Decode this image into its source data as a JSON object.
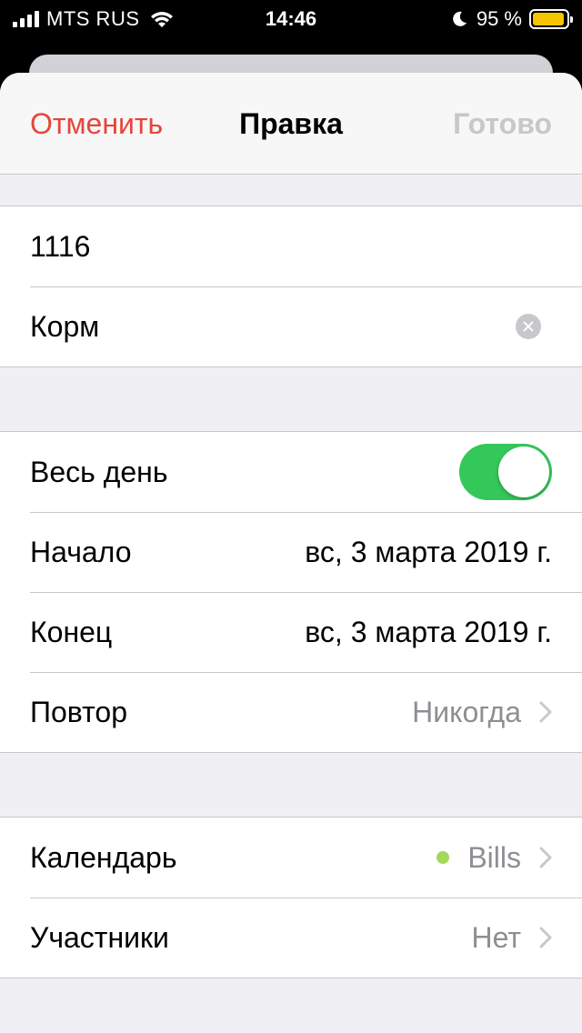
{
  "status_bar": {
    "carrier": "MTS RUS",
    "time": "14:46",
    "battery_percent": "95 %",
    "battery_level": 0.95,
    "battery_color": "#f5c400"
  },
  "nav": {
    "cancel": "Отменить",
    "title": "Правка",
    "done": "Готово"
  },
  "event": {
    "title": "1116",
    "location": "Корм"
  },
  "dates": {
    "all_day_label": "Весь день",
    "all_day_on": true,
    "start_label": "Начало",
    "start_value": "вс, 3 марта 2019 г.",
    "end_label": "Конец",
    "end_value": "вс, 3 марта 2019 г.",
    "repeat_label": "Повтор",
    "repeat_value": "Никогда"
  },
  "calendar": {
    "calendar_label": "Календарь",
    "calendar_value": "Bills",
    "calendar_color": "#a3d95a",
    "invitees_label": "Участники",
    "invitees_value": "Нет"
  }
}
